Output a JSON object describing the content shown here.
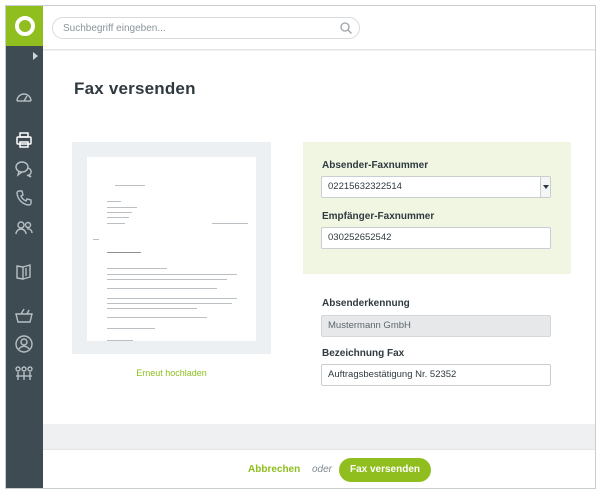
{
  "search": {
    "placeholder": "Suchbegriff eingeben..."
  },
  "page": {
    "title": "Fax versenden"
  },
  "preview": {
    "reupload_label": "Erneut hochladen"
  },
  "form": {
    "sender_fax": {
      "label": "Absender-Faxnummer",
      "value": "02215632322514"
    },
    "recipient_fax": {
      "label": "Empfänger-Faxnummer",
      "value": "030252652542"
    },
    "sender_id": {
      "label": "Absenderkennung",
      "value": "Mustermann GmbH"
    },
    "fax_name": {
      "label": "Bezeichnung Fax",
      "value": "Auftragsbestätigung Nr. 52352"
    }
  },
  "footer": {
    "cancel_label": "Abbrechen",
    "or_label": "oder",
    "send_label": "Fax versenden"
  },
  "icons": {
    "logo": "logo-ring-icon",
    "sidebar": [
      "expand-arrow-icon",
      "dashboard-gauge-icon",
      "printer-icon",
      "chat-bubbles-icon",
      "phone-icon",
      "users-icon",
      "book-icon",
      "basket-icon",
      "user-circle-icon",
      "organization-icon"
    ],
    "search": "search-icon"
  },
  "colors": {
    "accent": "#8fbe1e",
    "sidebar": "#3e4b52",
    "panel": "#f1f6e3"
  }
}
